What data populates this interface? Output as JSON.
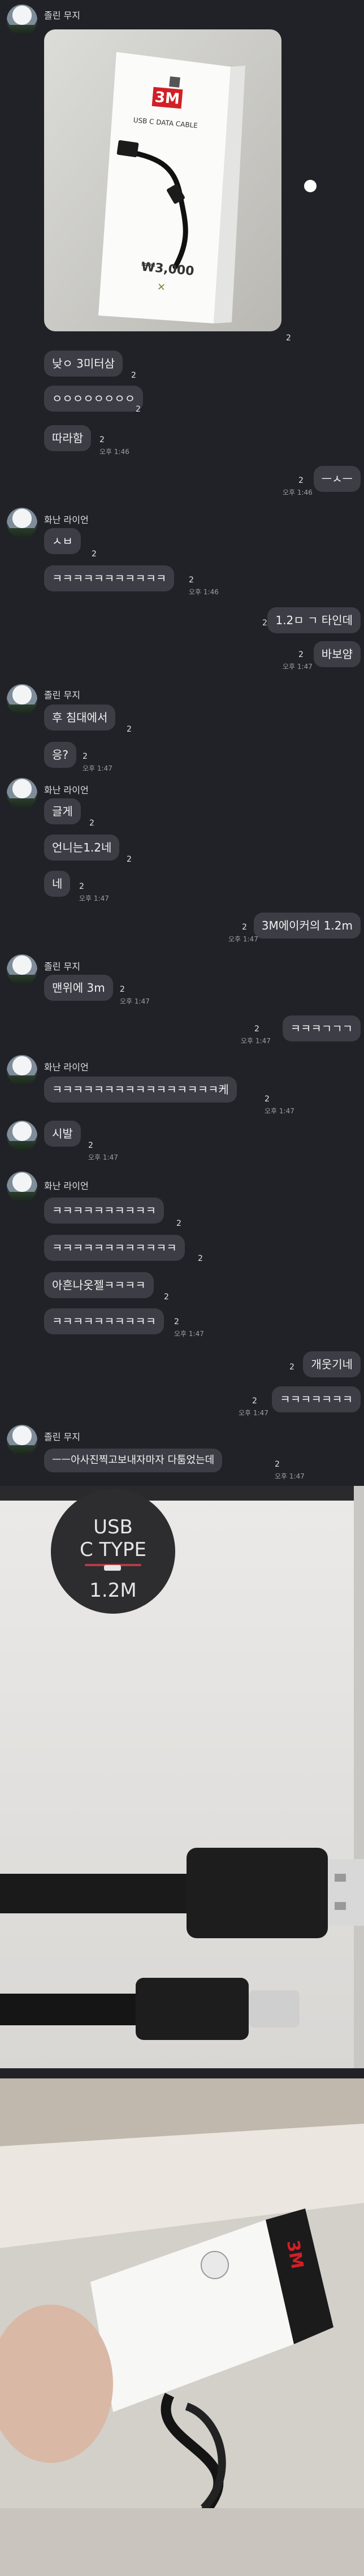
{
  "user_a": "졸린 무지",
  "user_b": "화난 라이언",
  "first_photo": {
    "box_label": "USB C DATA CABLE",
    "brand": "3M",
    "price": "₩3,000",
    "count": "2"
  },
  "messages": [
    {
      "text": "낮ㅇ 3미터삼",
      "count": "2"
    },
    {
      "text": "ㅇㅇㅇㅇㅇㅇㅇㅇ",
      "count": "2"
    },
    {
      "text": "따라함",
      "count": "2",
      "time": "오후 1:46"
    },
    {
      "text": "ㅡㅅㅡ",
      "count": "2",
      "time": "오후 1:46"
    },
    {
      "text": "ㅅㅂ",
      "count": "2"
    },
    {
      "text": "ㅋㅋㅋㅋㅋㅋㅋㅋㅋㅋㅋ",
      "count": "2",
      "time": "오후 1:46"
    },
    {
      "text": "1.2ㅁ ㄱ 타인데",
      "count": "2"
    },
    {
      "text": "바보얌",
      "count": "2",
      "time": "오후 1:47"
    },
    {
      "text": "후 침대에서",
      "count": "2"
    },
    {
      "text": "응?",
      "count": "2",
      "time": "오후 1:47"
    },
    {
      "text": "글게",
      "count": "2"
    },
    {
      "text": "언니는1.2네",
      "count": "2"
    },
    {
      "text": "네",
      "count": "2",
      "time": "오후 1:47"
    },
    {
      "text": "3M에이커의 1.2m",
      "count": "2",
      "time": "오후 1:47"
    },
    {
      "text": "맨위에 3m",
      "count": "2",
      "time": "오후 1:47"
    },
    {
      "text": "ㅋㅋㅋㄱㄱㄱ",
      "count": "2",
      "time": "오후 1:47"
    },
    {
      "text": "ㅋㅋㅋㅋㅋㅋㅋㅋㅋㅋㅋㅋㅋㅋㅋㅋ케",
      "count": "2",
      "time": "오후 1:47"
    },
    {
      "text": "시발",
      "count": "2",
      "time": "오후 1:47"
    },
    {
      "text": "ㅋㅋㅋㅋㅋㅋㅋㅋㅋㅋ",
      "count": "2"
    },
    {
      "text": "ㅋㅋㅋㅋㅋㅋㅋㅋㅋㅋㅋㅋ",
      "count": "2"
    },
    {
      "text": "아흔나옷젤ㅋㅋㅋㅋ",
      "count": "2"
    },
    {
      "text": "ㅋㅋㅋㅋㅋㅋㅋㅋㅋㅋ",
      "count": "2",
      "time": "오후 1:47"
    },
    {
      "text": "개웃기네",
      "count": "2"
    },
    {
      "text": "ㅋㅋㅋㅋㅋㅋㅋ",
      "count": "2",
      "time": "오후 1:47"
    },
    {
      "text": "ㅡㅡ아사진찍고보내자마자 다툼었는데",
      "count": "2",
      "time": "오후 1:47"
    }
  ],
  "closeup": {
    "line1": "USB",
    "line2": "C TYPE",
    "length": "1.2M"
  },
  "second_photo": {
    "brand": "3M"
  }
}
